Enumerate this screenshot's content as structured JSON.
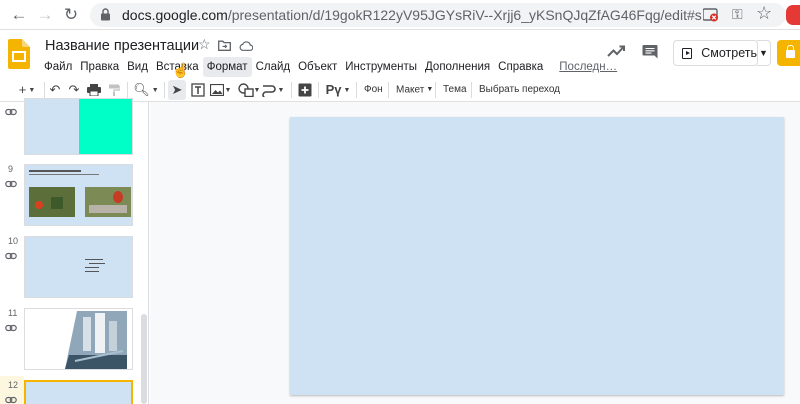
{
  "browser": {
    "url_host": "docs.google.com",
    "url_path": "/presentation/d/19gokR122yV95JGYsRiV--Xrjj6_yKSnQJqZfAG46Fqg/edit#slide=id.g8…",
    "icons": [
      "back-icon",
      "forward-icon",
      "reload-icon",
      "lock-icon",
      "extension-icon",
      "key-icon",
      "star-icon",
      "opera-icon"
    ]
  },
  "app": {
    "title": "Название презентации",
    "menu": [
      "Файл",
      "Правка",
      "Вид",
      "Вставка",
      "Формат",
      "Слайд",
      "Объект",
      "Инструменты",
      "Дополнения",
      "Справка"
    ],
    "last_edit": "Последн…",
    "present_label": "Смотреть"
  },
  "toolbar": {
    "background": "Фон",
    "layout": "Макет",
    "theme": "Тема",
    "transition": "Выбрать переход"
  },
  "filmstrip": {
    "slides": [
      {
        "number": "9"
      },
      {
        "number": "10"
      },
      {
        "number": "11"
      },
      {
        "number": "12"
      }
    ]
  },
  "colors": {
    "accent": "#f4b400",
    "slide_background": "#cfe2f3",
    "teal_block": "#00ffc6",
    "canvas_bg": "#f8f9fa"
  }
}
